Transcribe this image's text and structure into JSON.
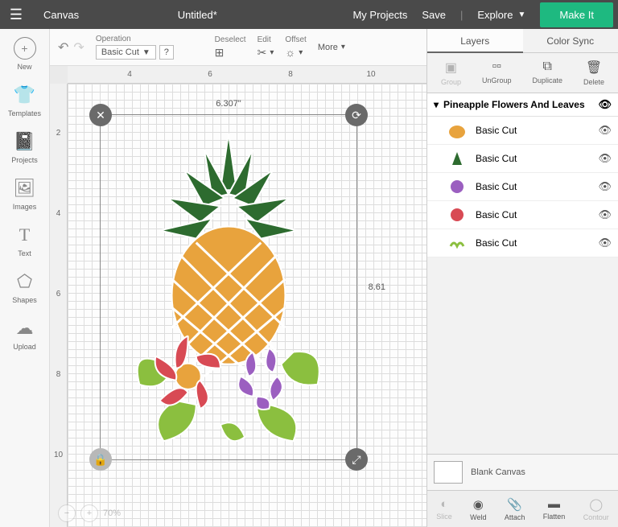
{
  "topbar": {
    "app": "Canvas",
    "title": "Untitled*",
    "my_projects": "My Projects",
    "save": "Save",
    "explore": "Explore",
    "make_it": "Make It"
  },
  "sidebar": [
    {
      "label": "New",
      "icon": "+"
    },
    {
      "label": "Templates",
      "icon": "👕"
    },
    {
      "label": "Projects",
      "icon": "📓"
    },
    {
      "label": "Images",
      "icon": "🖼"
    },
    {
      "label": "Text",
      "icon": "T"
    },
    {
      "label": "Shapes",
      "icon": "⬠"
    },
    {
      "label": "Upload",
      "icon": "☁"
    }
  ],
  "options": {
    "operation_label": "Operation",
    "operation_value": "Basic Cut",
    "help": "?",
    "deselect": "Deselect",
    "edit": "Edit",
    "offset": "Offset",
    "more": "More"
  },
  "ruler_h": [
    "4",
    "6",
    "8",
    "10"
  ],
  "ruler_v": [
    "2",
    "4",
    "6",
    "8",
    "10"
  ],
  "selection": {
    "width": "6.307\"",
    "height": "8.61"
  },
  "zoom": {
    "value": "70%"
  },
  "right": {
    "tabs": {
      "layers": "Layers",
      "color_sync": "Color Sync"
    },
    "actions": {
      "group": "Group",
      "ungroup": "UnGroup",
      "duplicate": "Duplicate",
      "delete": "Delete"
    },
    "group_name": "Pineapple Flowers And Leaves",
    "layers": [
      {
        "label": "Basic Cut",
        "color": "#e8a33d"
      },
      {
        "label": "Basic Cut",
        "color": "#2d6b2f"
      },
      {
        "label": "Basic Cut",
        "color": "#9b5fc0"
      },
      {
        "label": "Basic Cut",
        "color": "#d84a54"
      },
      {
        "label": "Basic Cut",
        "color": "#8bbf3f"
      }
    ],
    "blank": "Blank Canvas",
    "bottom": {
      "slice": "Slice",
      "weld": "Weld",
      "attach": "Attach",
      "flatten": "Flatten",
      "contour": "Contour"
    }
  }
}
